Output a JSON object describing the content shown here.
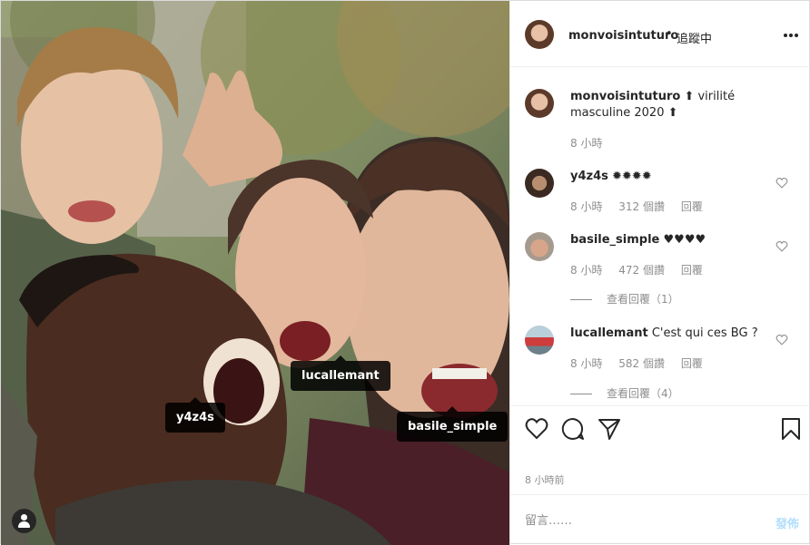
{
  "photo_tags": [
    {
      "username": "lucallemant"
    },
    {
      "username": "y4z4s"
    },
    {
      "username": "basile_simple"
    }
  ],
  "header": {
    "username": "monvoisintuturo",
    "separator": "•",
    "follow_status": "追蹤中"
  },
  "caption": {
    "username": "monvoisintuturo",
    "text": "⬆ virilité masculine 2020 ⬆",
    "time": "8 小時"
  },
  "comments": [
    {
      "username": "y4z4s",
      "text": "✹✹✹✹",
      "time": "8 小時",
      "likes": "312 個讚",
      "reply": "回覆"
    },
    {
      "username": "basile_simple",
      "text": "♥♥♥♥",
      "time": "8 小時",
      "likes": "472 個讚",
      "reply": "回覆",
      "view_replies": "查看回覆（1）"
    },
    {
      "username": "lucallemant",
      "text": "C'est qui ces BG ?",
      "time": "8 小時",
      "likes": "582 個讚",
      "reply": "回覆",
      "view_replies": "查看回覆（4）"
    }
  ],
  "footer": {
    "timestamp": "8 小時前",
    "comment_placeholder": "留言……",
    "post_label": "發佈"
  },
  "colors": {
    "link_disabled": "#b2dffc",
    "text": "#262626",
    "muted": "#8e8e8e",
    "border": "#efefef"
  },
  "icons": [
    "heart-icon",
    "comment-icon",
    "share-icon",
    "bookmark-icon",
    "more-options-icon",
    "tagged-user-icon"
  ]
}
